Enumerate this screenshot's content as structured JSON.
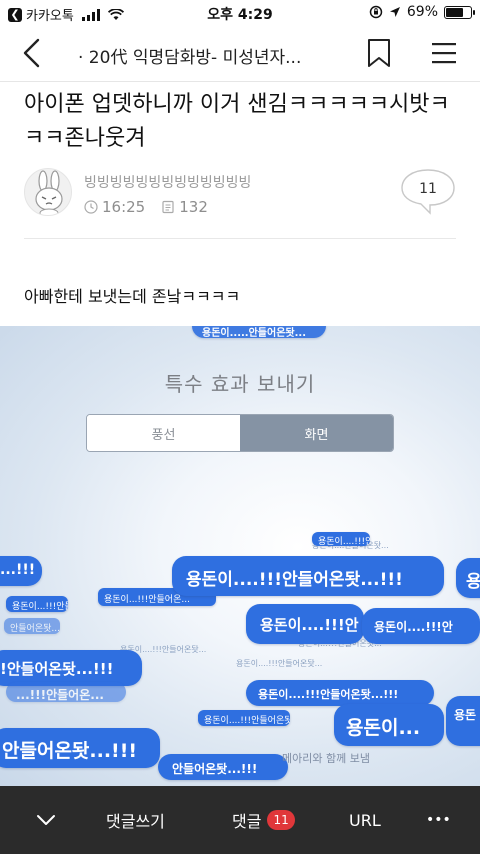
{
  "status_bar": {
    "carrier": "카카오톡",
    "time": "오후 4:29",
    "battery": "69%",
    "battery_level": 0.69
  },
  "nav": {
    "title": "· 20代 익명담화방- 미성년자..."
  },
  "post": {
    "title": "아이폰 업뎃하니까 이거 샌김ㅋㅋㅋㅋㅋ시밧ㅋㅋㅋ존나웃겨",
    "author": "빙빙빙빙빙빙빙빙빙빙빙빙빙",
    "time": "16:25",
    "views": "132",
    "comment_count": "11",
    "body": "아빠한테 보냇는데 존낰ㅋㅋㅋㅋ"
  },
  "screenshot": {
    "effects_title": "특수 효과 보내기",
    "segment_options": [
      "풍선",
      "화면"
    ],
    "selected_option": "화면",
    "caption": "메아리와 함께 보냄",
    "bubbles": {
      "b1": "...!!!",
      "b2": "용돈이....!!!안들어온돳...!!!",
      "b3": "용돈이....!!!안",
      "b4": "용돈이....!!!안",
      "b5": "!안들어온돳...!!!",
      "b6": "용돈이....!!!안들어온돳...!!!",
      "b7": "용돈이...",
      "b8": "안들어온돳...!!!",
      "b9": "안들어온돳...!!!",
      "s1": "용돈이...!!!안들어온...",
      "s2": "안들어온돳...",
      "s3": "용돈이....!!!안들어온돳...!!!",
      "s4": "용돈이....!!!안들어온돳"
    }
  },
  "toolbar": {
    "write_comment": "댓글쓰기",
    "comments": "댓글",
    "comment_badge": "11",
    "url": "URL",
    "more": "•••"
  }
}
